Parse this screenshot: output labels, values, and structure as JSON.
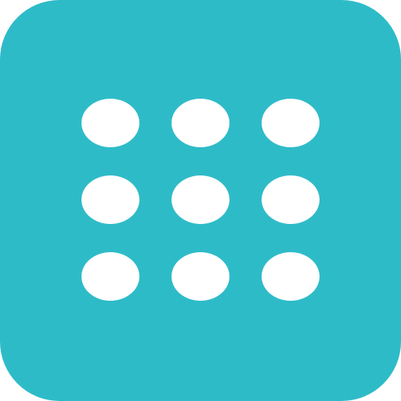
{
  "icon": {
    "name": "grid-dots-icon",
    "colors": {
      "background": "#2ebbc8",
      "dot": "#ffffff"
    },
    "rows": 3,
    "columns": 3
  }
}
